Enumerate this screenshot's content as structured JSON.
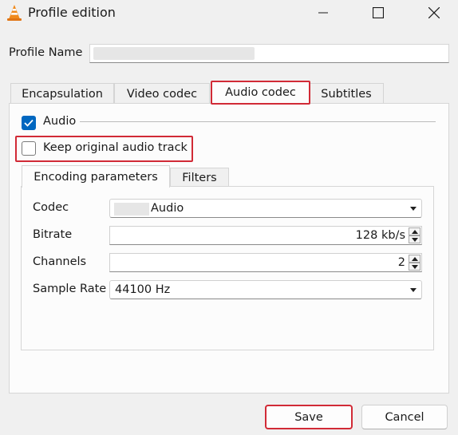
{
  "window": {
    "title": "Profile edition",
    "minimize_icon": "minimize-icon",
    "maximize_icon": "maximize-icon",
    "close_icon": "close-icon",
    "app_icon": "vlc-cone-icon"
  },
  "profile": {
    "label": "Profile Name"
  },
  "tabs": [
    {
      "label": "Encapsulation"
    },
    {
      "label": "Video codec"
    },
    {
      "label": "Audio codec",
      "active": true,
      "highlighted": true
    },
    {
      "label": "Subtitles"
    }
  ],
  "audio": {
    "enable_label": "Audio",
    "enabled": true,
    "keep_original_label": "Keep original audio track",
    "keep_original": false
  },
  "inner_tabs": [
    {
      "label": "Encoding parameters",
      "active": true
    },
    {
      "label": "Filters"
    }
  ],
  "params": {
    "codec_label": "Codec",
    "codec_value": "Audio",
    "bitrate_label": "Bitrate",
    "bitrate_value": "128 kb/s",
    "channels_label": "Channels",
    "channels_value": "2",
    "sample_rate_label": "Sample Rate",
    "sample_rate_value": "44100 Hz"
  },
  "buttons": {
    "save": "Save",
    "cancel": "Cancel"
  },
  "colors": {
    "highlight": "#d12a36",
    "checkbox_checked": "#0067c0",
    "window_bg": "#f0f0f0"
  }
}
